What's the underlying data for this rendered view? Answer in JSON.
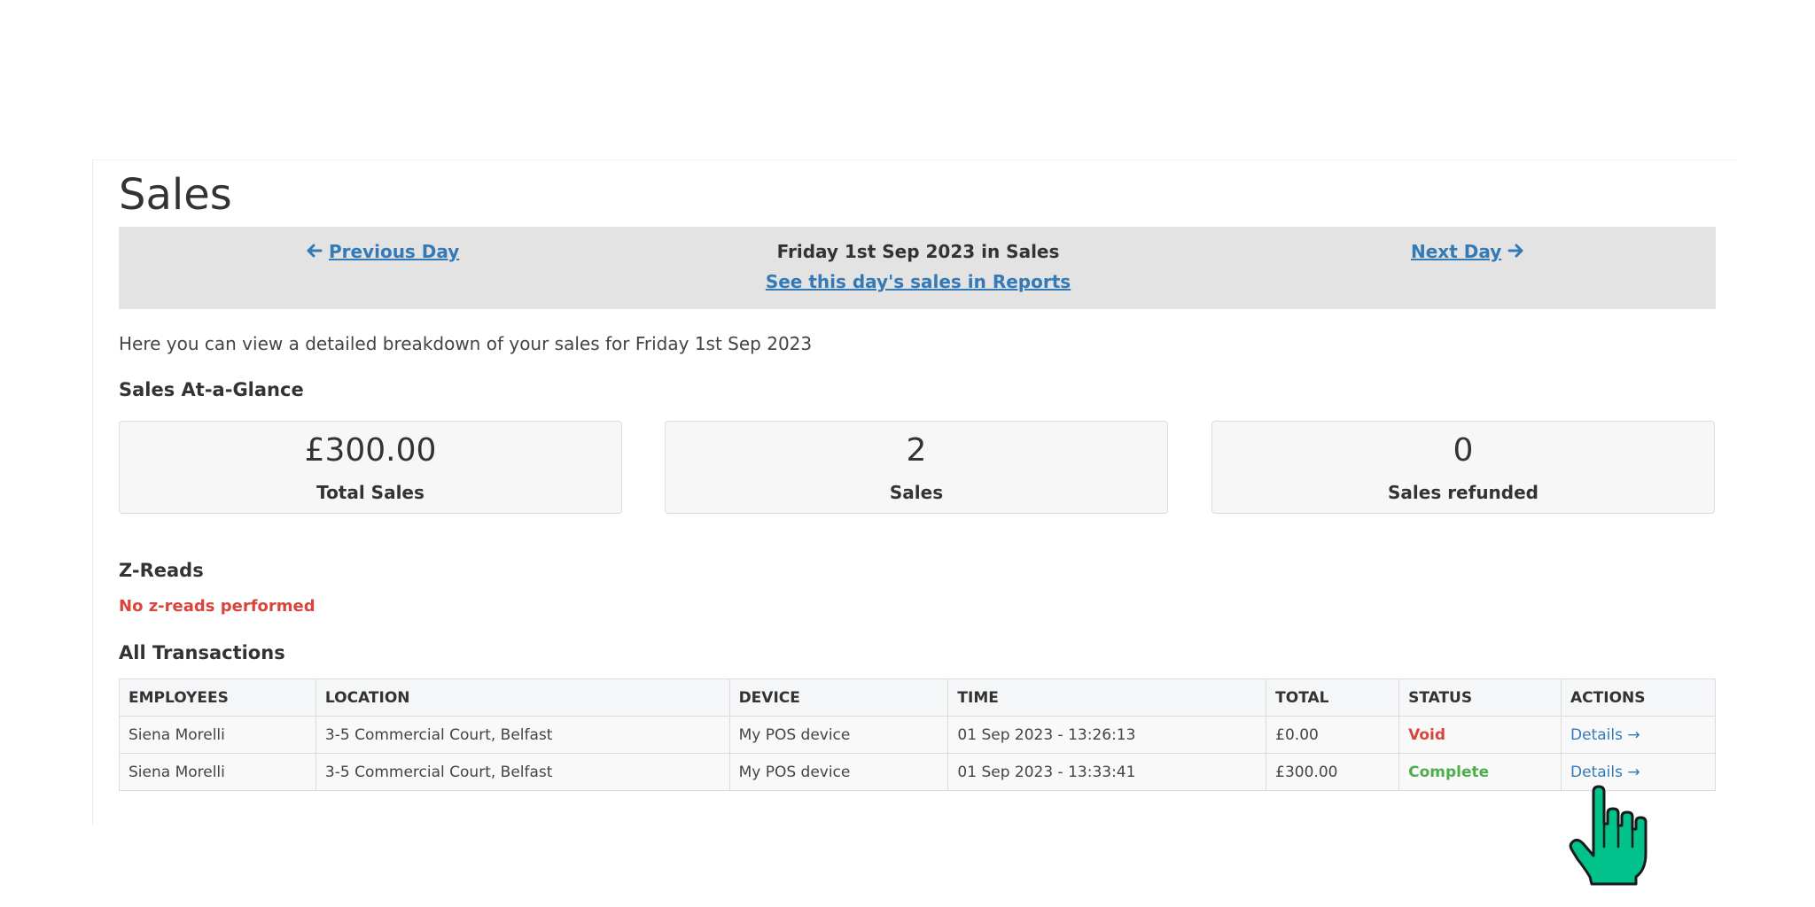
{
  "page": {
    "title": "Sales"
  },
  "day_nav": {
    "prev_label": "Previous Day",
    "next_label": "Next Day",
    "current_day": "Friday 1st Sep 2023 in Sales",
    "reports_link": "See this day's sales in Reports"
  },
  "intro": "Here you can view a detailed breakdown of your sales for Friday 1st Sep 2023",
  "glance": {
    "heading": "Sales At-a-Glance",
    "stats": [
      {
        "value": "£300.00",
        "label": "Total Sales"
      },
      {
        "value": "2",
        "label": "Sales"
      },
      {
        "value": "0",
        "label": "Sales refunded"
      }
    ]
  },
  "zreads": {
    "heading": "Z-Reads",
    "message": "No z-reads performed",
    "message_color": "#d9453b"
  },
  "transactions": {
    "heading": "All Transactions",
    "columns": [
      "EMPLOYEES",
      "LOCATION",
      "DEVICE",
      "TIME",
      "TOTAL",
      "STATUS",
      "ACTIONS"
    ],
    "rows": [
      {
        "employee": "Siena Morelli",
        "location": "3-5 Commercial Court, Belfast",
        "device": "My POS device",
        "time": "01 Sep 2023 - 13:26:13",
        "total": "£0.00",
        "status": "Void",
        "action": "Details →"
      },
      {
        "employee": "Siena Morelli",
        "location": "3-5 Commercial Court, Belfast",
        "device": "My POS device",
        "time": "01 Sep 2023 - 13:33:41",
        "total": "£300.00",
        "status": "Complete",
        "action": "Details →"
      }
    ]
  },
  "icons": {
    "prev": "arrow-left-icon",
    "next": "arrow-right-icon",
    "cursor": "hand-pointer-cursor-icon"
  },
  "colors": {
    "link": "#337ab7",
    "void": "#d9453b",
    "complete": "#4cae4c",
    "cursor": "#00c28a"
  }
}
